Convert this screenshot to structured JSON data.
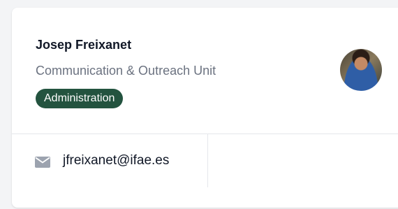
{
  "person": {
    "name": "Josep Freixanet",
    "unit": "Communication & Outreach Unit",
    "role_badge": "Administration",
    "email": "jfreixanet@ifae.es"
  },
  "icons": {
    "contact": "mail-icon",
    "avatar": "avatar-photo"
  },
  "colors": {
    "badge_bg": "#23533f",
    "badge_text": "#ffffff",
    "name_text": "#111827",
    "secondary_text": "#6b7280",
    "icon": "#9ca3af"
  }
}
